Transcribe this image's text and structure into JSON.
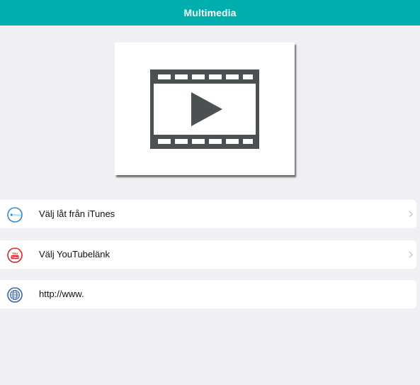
{
  "header": {
    "title": "Multimedia",
    "background_color": "#00aeae"
  },
  "media_card": {
    "icon": "film-play-icon"
  },
  "list": {
    "items": [
      {
        "label": "Välj låt från iTunes",
        "icon": "itunes-icon",
        "has_chevron": true,
        "icon_label": "iTunes"
      },
      {
        "label": "Välj YouTubelänk",
        "icon": "youtube-icon",
        "has_chevron": true,
        "icon_label_top": "You",
        "icon_label_bottom": "Tube"
      },
      {
        "label": "http://www.",
        "icon": "globe-icon",
        "has_chevron": false
      }
    ]
  }
}
